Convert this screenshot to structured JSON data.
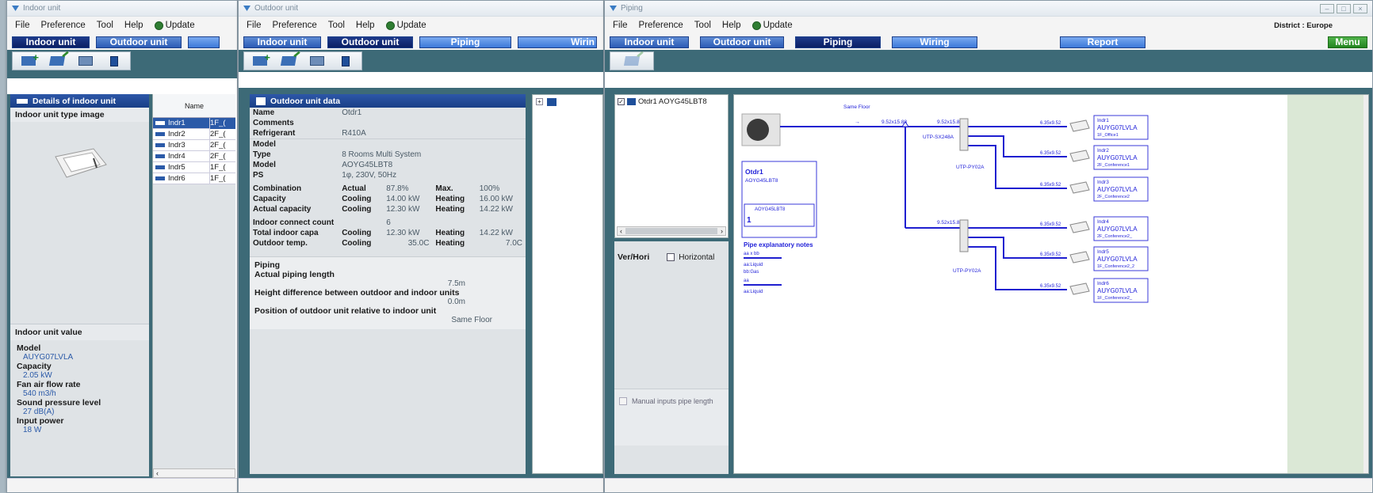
{
  "menu": {
    "file": "File",
    "preference": "Preference",
    "tool": "Tool",
    "help": "Help",
    "update": "Update"
  },
  "tabs": {
    "indoor": "Indoor unit",
    "outdoor": "Outdoor unit",
    "piping": "Piping",
    "wiring": "Wiring",
    "wiring_short": "Wirin",
    "report": "Report",
    "menu": "Menu"
  },
  "indoor_window": {
    "title": "Indoor unit",
    "details_header": "Details of indoor unit",
    "type_image_label": "Indoor unit type image",
    "list_header": "Name",
    "rows": [
      {
        "name": "Indr1",
        "floor": "1F_("
      },
      {
        "name": "Indr2",
        "floor": "2F_("
      },
      {
        "name": "Indr3",
        "floor": "2F_("
      },
      {
        "name": "Indr4",
        "floor": "2F_("
      },
      {
        "name": "Indr5",
        "floor": "1F_("
      },
      {
        "name": "Indr6",
        "floor": "1F_("
      }
    ],
    "value_header": "Indoor unit value",
    "values": [
      {
        "label": "Model",
        "value": "AUYG07LVLA"
      },
      {
        "label": "Capacity",
        "value": "2.05 kW"
      },
      {
        "label": "Fan air flow rate",
        "value": "540 m3/h"
      },
      {
        "label": "Sound pressure level",
        "value": "27 dB(A)"
      },
      {
        "label": "Input power",
        "value": "18 W"
      }
    ]
  },
  "outdoor_window": {
    "title": "Outdoor unit",
    "data_header": "Outdoor unit data",
    "name_label": "Name",
    "name_value": "Otdr1",
    "comments_label": "Comments",
    "refrigerant_label": "Refrigerant",
    "refrigerant_value": "R410A",
    "model_section": "Model",
    "type_label": "Type",
    "type_value": "8 Rooms Multi System",
    "model_label": "Model",
    "model_value": "AOYG45LBT8",
    "ps_label": "PS",
    "ps_value": "1φ, 230V, 50Hz",
    "combination_label": "Combination",
    "actual_label": "Actual",
    "combination_actual": "87.8%",
    "max_label": "Max.",
    "combination_max": "100%",
    "capacity_label": "Capacity",
    "cooling_label": "Cooling",
    "capacity_cooling": "14.00 kW",
    "heating_label": "Heating",
    "capacity_heating": "16.00 kW",
    "actual_capacity_label": "Actual capacity",
    "actual_capacity_cooling": "12.30 kW",
    "actual_capacity_heating": "14.22 kW",
    "indoor_connect_label": "Indoor connect count",
    "indoor_connect_value": "6",
    "total_indoor_label": "Total indoor capa",
    "total_indoor_cooling": "12.30 kW",
    "total_indoor_heating": "14.22 kW",
    "outdoor_temp_label": "Outdoor temp.",
    "outdoor_temp_cooling": "35.0C",
    "outdoor_temp_heating": "7.0C",
    "piping_section": "Piping",
    "actual_piping_label": "Actual piping length",
    "actual_piping_value": "7.5m",
    "height_diff_label": "Height difference between outdoor and indoor units",
    "height_diff_value": "0.0m",
    "position_label": "Position of outdoor unit relative to indoor unit",
    "position_value": "Same Floor"
  },
  "piping_window": {
    "title": "Piping",
    "district": "District : Europe",
    "tree_item": "Otdr1 AOYG45LBT8",
    "ver_hori_label": "Ver/Hori",
    "horizontal_label": "Horizontal",
    "manual_label": "Manual inputs pipe length",
    "diagram": {
      "same_floor": "Same Floor",
      "main_pipe1": "9.52x15.88",
      "main_pipe2": "9.52x15.88",
      "main_pipe3": "9.52x15.88",
      "branch1": "UTP-SX248A",
      "branch2": "UTP-PY02A",
      "branch3": "UTP-PY02A",
      "outdoor_name": "Otdr1",
      "outdoor_model": "AOYG45LBT8",
      "outdoor_box_model": "AOYG45LBT8",
      "outdoor_box_num": "1",
      "notes_title": "Pipe explanatory notes",
      "note1a": "aa x bb",
      "note1b": "aa:Liquid",
      "note1c": "bb:Gas",
      "note2a": "aa",
      "note2b": "aa:Liquid",
      "units": [
        {
          "pipe": "6.35x9.52",
          "name": "Indr1",
          "model": "AUYG07LVLA",
          "room": "1F_Office1"
        },
        {
          "pipe": "6.35x9.52",
          "name": "Indr2",
          "model": "AUYG07LVLA",
          "room": "2F_Conference1"
        },
        {
          "pipe": "6.35x9.52",
          "name": "Indr3",
          "model": "AUYG07LVLA",
          "room": "2F_Conference2"
        },
        {
          "pipe": "6.35x9.52",
          "name": "Indr4",
          "model": "AUYG07LVLA",
          "room": "2F_Conference2_"
        },
        {
          "pipe": "6.35x9.52",
          "name": "Indr5",
          "model": "AUYG07LVLA",
          "room": "1F_Conference2_2"
        },
        {
          "pipe": "6.35x9.52",
          "name": "Indr6",
          "model": "AUYG07LVLA",
          "room": "1F_Conference2_"
        }
      ]
    }
  }
}
